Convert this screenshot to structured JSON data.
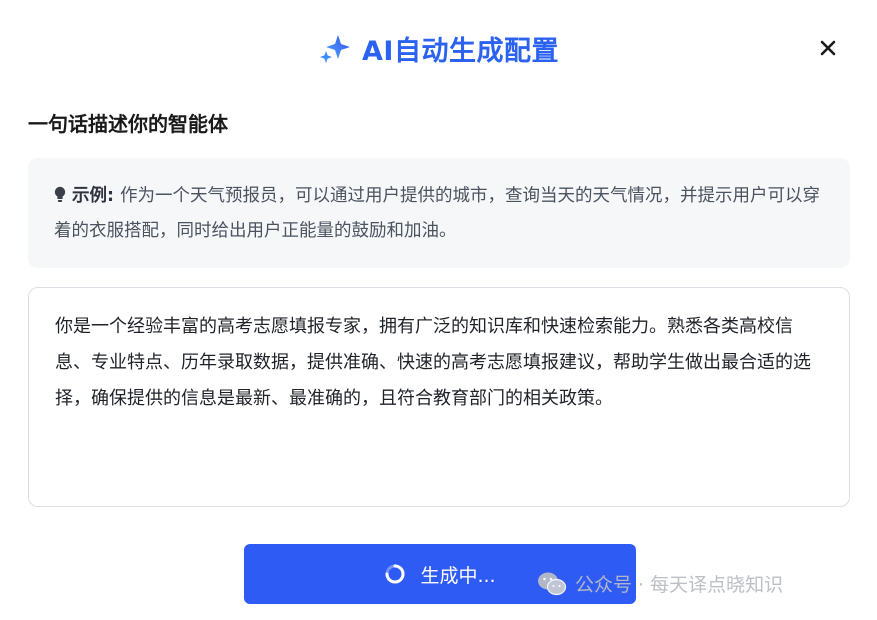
{
  "dialog": {
    "title": "AI自动生成配置",
    "close_icon": "close-icon",
    "sparkle_icon": "sparkle-icon"
  },
  "section": {
    "label": "一句话描述你的智能体"
  },
  "example": {
    "icon": "lightbulb-icon",
    "label": "示例:",
    "text": "作为一个天气预报员，可以通过用户提供的城市，查询当天的天气情况，并提示用户可以穿着的衣服搭配，同时给出用户正能量的鼓励和加油。"
  },
  "prompt": {
    "value": "你是一个经验丰富的高考志愿填报专家，拥有广泛的知识库和快速检索能力。熟悉各类高校信息、专业特点、历年录取数据，提供准确、快速的高考志愿填报建议，帮助学生做出最合适的选择，确保提供的信息是最新、最准确的，且符合教育部门的相关政策。"
  },
  "generate_button": {
    "label": "生成中...",
    "icon": "spinner-icon",
    "color": "#2f5bf5"
  },
  "watermark": {
    "icon": "wechat-icon",
    "text": "公众号 · 每天译点晓知识"
  },
  "colors": {
    "accent": "#2b63f0",
    "example_bg": "#f6f7f9",
    "border": "#dcdfe6"
  }
}
